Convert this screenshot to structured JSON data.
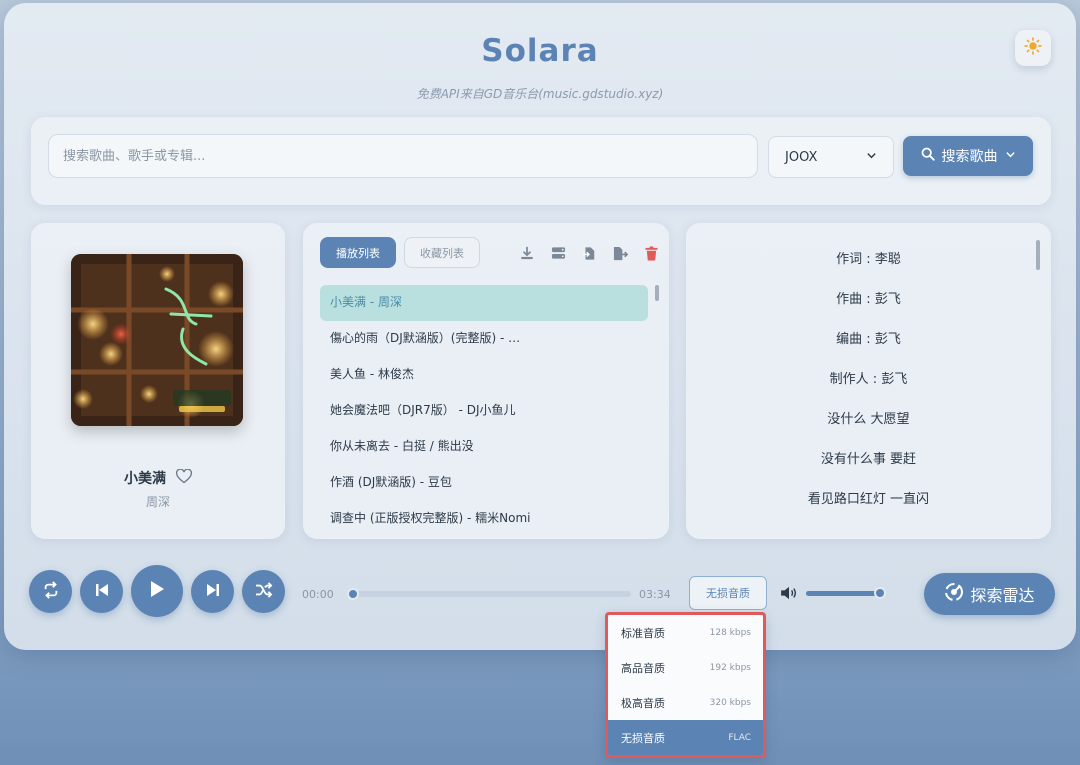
{
  "app": {
    "title": "Solara",
    "subtitle": "免费API来自GD音乐台(music.gdstudio.xyz)",
    "theme_icon": "sun-icon"
  },
  "search": {
    "placeholder": "搜索歌曲、歌手或专辑...",
    "value": "",
    "source": "JOOX",
    "button_label": "搜索歌曲"
  },
  "now_playing": {
    "title": "小美满",
    "artist": "周深",
    "favorited": false
  },
  "playlist": {
    "tabs": [
      {
        "label": "播放列表",
        "active": true
      },
      {
        "label": "收藏列表",
        "active": false
      }
    ],
    "tools": [
      "download-icon",
      "storage-icon",
      "import-icon",
      "export-icon",
      "trash-icon"
    ],
    "items": [
      {
        "label": "小美满 - 周深",
        "active": true
      },
      {
        "label": "傷心的雨（DJ默涵版）(完整版) - …",
        "active": false
      },
      {
        "label": "美人鱼 - 林俊杰",
        "active": false
      },
      {
        "label": "她会魔法吧（DJR7版） - DJ小鱼儿",
        "active": false
      },
      {
        "label": "你从未离去 - 白挺 / 熊出没",
        "active": false
      },
      {
        "label": "作酒 (DJ默涵版) - 豆包",
        "active": false
      },
      {
        "label": "调查中 (正版授权完整版) - 糯米Nomi",
        "active": false
      }
    ]
  },
  "lyrics": [
    "作词 : 李聪",
    "作曲 : 彭飞",
    "编曲 : 彭飞",
    "制作人 : 彭飞",
    "没什么 大愿望",
    "没有什么事 要赶",
    "看见路口红灯 一直闪"
  ],
  "player": {
    "current_time": "00:00",
    "duration": "03:34",
    "progress_fraction": 0.02,
    "volume_fraction": 0.97,
    "quality_label": "无损音质",
    "radar_label": "探索雷达"
  },
  "quality_menu": [
    {
      "label": "标准音质",
      "rate": "128 kbps",
      "selected": false
    },
    {
      "label": "高品音质",
      "rate": "192 kbps",
      "selected": false
    },
    {
      "label": "极高音质",
      "rate": "320 kbps",
      "selected": false
    },
    {
      "label": "无损音质",
      "rate": "FLAC",
      "selected": true
    }
  ],
  "colors": {
    "accent": "#5b84b5",
    "active_row": "#b9e0df",
    "delete": "#e05a5a",
    "highlight_border": "#e05a5a"
  }
}
